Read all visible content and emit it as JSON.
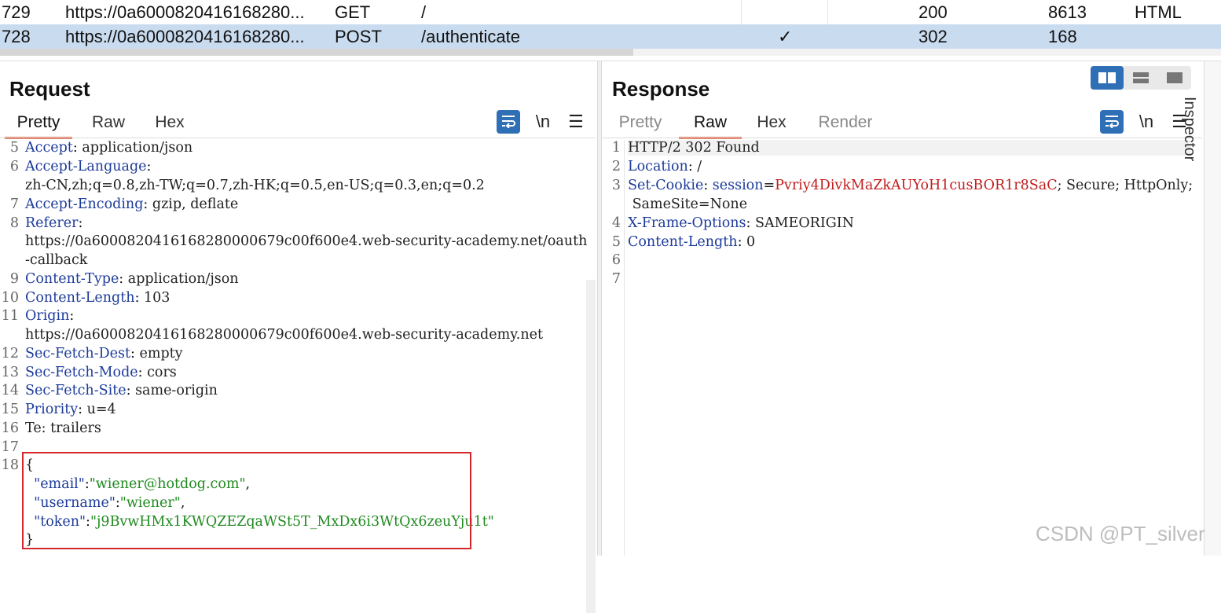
{
  "history": {
    "rows": [
      {
        "num": "729",
        "url": "https://0a6000820416168280...",
        "method": "GET",
        "path": "/",
        "edited": "",
        "status": "200",
        "length": "8613",
        "mime": "HTML"
      },
      {
        "num": "728",
        "url": "https://0a6000820416168280...",
        "method": "POST",
        "path": "/authenticate",
        "edited": "✓",
        "status": "302",
        "length": "168",
        "mime": ""
      }
    ]
  },
  "request": {
    "title": "Request",
    "tabs": [
      "Pretty",
      "Raw",
      "Hex"
    ],
    "active_tab": "Pretty",
    "newline_label": "\\n",
    "menu_label": "☰",
    "lines": [
      {
        "n": "5",
        "k": "Accept",
        "v": " application/json"
      },
      {
        "n": "6",
        "k": "Accept-Language",
        "v": ""
      },
      {
        "n": "",
        "k": "",
        "v": "zh-CN,zh;q=0.8,zh-TW;q=0.7,zh-HK;q=0.5,en-US;q=0.3,en;q=0.2"
      },
      {
        "n": "7",
        "k": "Accept-Encoding",
        "v": " gzip, deflate"
      },
      {
        "n": "8",
        "k": "Referer",
        "v": ""
      },
      {
        "n": "",
        "k": "",
        "v": "https://0a6000820416168280000679c00f600e4.web-security-academy.net/oauth"
      },
      {
        "n": "",
        "k": "",
        "v": "-callback"
      },
      {
        "n": "9",
        "k": "Content-Type",
        "v": " application/json"
      },
      {
        "n": "10",
        "k": "Content-Length",
        "v": " 103"
      },
      {
        "n": "11",
        "k": "Origin",
        "v": ""
      },
      {
        "n": "",
        "k": "",
        "v": "https://0a6000820416168280000679c00f600e4.web-security-academy.net"
      },
      {
        "n": "12",
        "k": "Sec-Fetch-Dest",
        "v": " empty"
      },
      {
        "n": "13",
        "k": "Sec-Fetch-Mode",
        "v": " cors"
      },
      {
        "n": "14",
        "k": "Sec-Fetch-Site",
        "v": " same-origin"
      },
      {
        "n": "15",
        "k": "Priority",
        "v": " u=4"
      },
      {
        "n": "16",
        "k": "",
        "v": "Te: trailers"
      },
      {
        "n": "17",
        "k": "",
        "v": ""
      }
    ],
    "body": {
      "line_no": "18",
      "open": "{",
      "close": "}",
      "fields": [
        {
          "key": "\"email\"",
          "value": "\"wiener@hotdog.com\"",
          "trail": ","
        },
        {
          "key": "\"username\"",
          "value": "\"wiener\"",
          "trail": ","
        },
        {
          "key": "\"token\"",
          "value": "\"j9BvwHMx1KWQZEZqaWSt5T_MxDx6i3WtQx6zeuYju1t\"",
          "trail": ""
        }
      ]
    }
  },
  "response": {
    "title": "Response",
    "tabs": [
      "Pretty",
      "Raw",
      "Hex",
      "Render"
    ],
    "active_tab": "Raw",
    "newline_label": "\\n",
    "menu_label": "☰",
    "lines": [
      {
        "n": "1",
        "k": "",
        "v": "HTTP/2 302 Found"
      },
      {
        "n": "2",
        "k": "Location",
        "v": " /"
      },
      {
        "n": "3",
        "k": "Set-Cookie",
        "cookie_name": "session",
        "cookie_value": "Pvriy4DivkMaZkAUYoH1cusBOR1r8SaC",
        "v": "; Secure; HttpOnly;"
      },
      {
        "n": "",
        "k": "",
        "v": " SameSite=None"
      },
      {
        "n": "4",
        "k": "X-Frame-Options",
        "v": " SAMEORIGIN"
      },
      {
        "n": "5",
        "k": "Content-Length",
        "v": " 0"
      },
      {
        "n": "6",
        "k": "",
        "v": ""
      },
      {
        "n": "7",
        "k": "",
        "v": ""
      }
    ]
  },
  "inspector_label": "Inspector",
  "watermark": "CSDN @PT_silver",
  "colors": {
    "accent": "#2f6fb5",
    "tab_underline": "#e06c4c",
    "highlight_border": "#d6262b",
    "selected_row": "#c9dbef"
  }
}
